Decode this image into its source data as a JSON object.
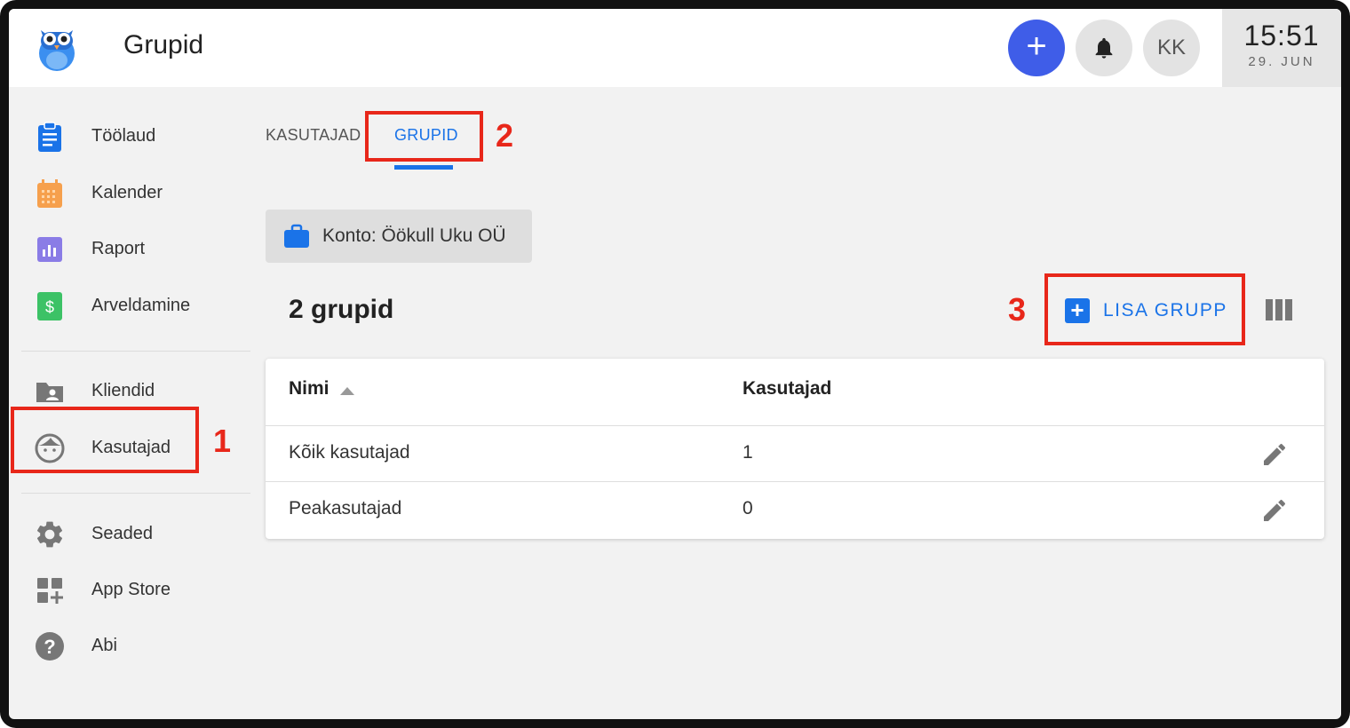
{
  "header": {
    "title": "Grupid",
    "add_label": "+",
    "avatar_initials": "KK",
    "clock_time": "15:51",
    "clock_date": "29. JUN"
  },
  "sidebar": {
    "items": [
      {
        "label": "Töölaud",
        "icon": "clipboard-icon",
        "color": "#1a73e8"
      },
      {
        "label": "Kalender",
        "icon": "calendar-icon",
        "color": "#f6a04d"
      },
      {
        "label": "Raport",
        "icon": "chart-icon",
        "color": "#8a7ce6"
      },
      {
        "label": "Arveldamine",
        "icon": "dollar-icon",
        "color": "#3cc266"
      },
      {
        "label": "Kliendid",
        "icon": "contacts-folder-icon",
        "color": "#777777"
      },
      {
        "label": "Kasutajad",
        "icon": "user-face-icon",
        "color": "#777777"
      },
      {
        "label": "Seaded",
        "icon": "gear-icon",
        "color": "#777777"
      },
      {
        "label": "App Store",
        "icon": "apps-add-icon",
        "color": "#777777"
      },
      {
        "label": "Abi",
        "icon": "help-icon",
        "color": "#777777"
      }
    ]
  },
  "tabs": [
    {
      "label": "KASUTAJAD",
      "active": false
    },
    {
      "label": "GRUPID",
      "active": true
    }
  ],
  "account": {
    "label": "Konto: Öökull Uku OÜ"
  },
  "main": {
    "count_title": "2 grupid",
    "add_group_label": "LISA GRUPP"
  },
  "table": {
    "headers": [
      "Nimi",
      "Kasutajad"
    ],
    "rows": [
      {
        "name": "Kõik kasutajad",
        "users": "1"
      },
      {
        "name": "Peakasutajad",
        "users": "0"
      }
    ]
  },
  "annotations": [
    "1",
    "2",
    "3"
  ],
  "colors": {
    "accent": "#1a73e8",
    "fab": "#3f5de8",
    "annotation": "#e8271a"
  }
}
